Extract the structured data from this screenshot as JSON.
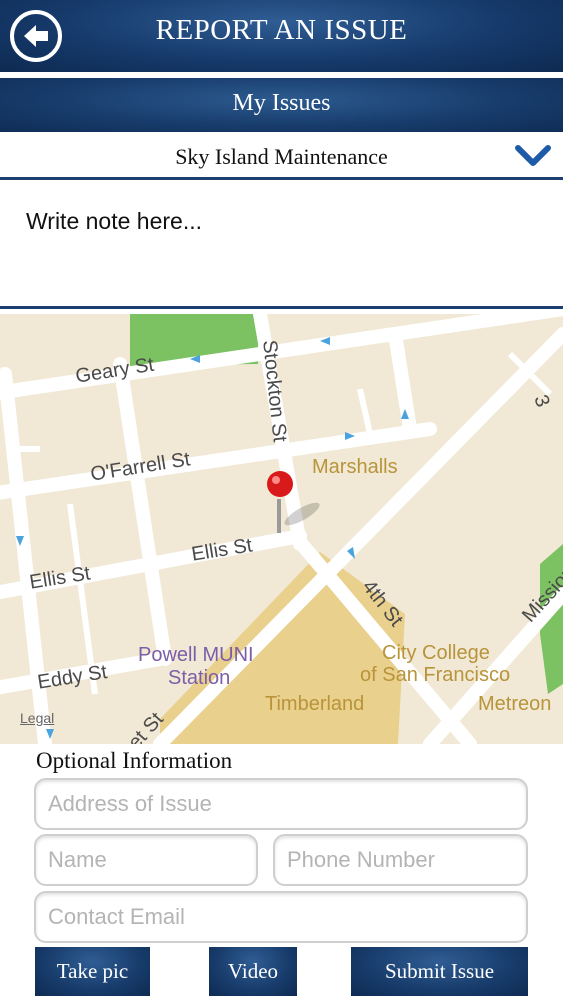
{
  "header": {
    "title": "REPORT AN ISSUE",
    "back_icon": "back-arrow-icon"
  },
  "my_issues": {
    "label": "My Issues"
  },
  "category_selector": {
    "selected": "Sky Island Maintenance",
    "icon": "chevron-down-icon"
  },
  "note": {
    "text": "Write note here..."
  },
  "map": {
    "streets": [
      "Geary St",
      "Stockton St",
      "O'Farrell St",
      "Ellis St",
      "Ellis St",
      "Eddy St",
      "4th St",
      "Mission",
      "et St",
      "3"
    ],
    "places": [
      "Marshalls",
      "Powell MUNI",
      "Station",
      "City College",
      "of San Francisco",
      "Timberland",
      "Metreon"
    ],
    "legal": "Legal",
    "pin_icon": "map-pin-icon"
  },
  "optional": {
    "title": "Optional Information",
    "address_placeholder": "Address of Issue",
    "name_placeholder": "Name",
    "phone_placeholder": "Phone Number",
    "email_placeholder": "Contact Email"
  },
  "actions": {
    "take_pic": "Take pic",
    "video": "Video",
    "submit": "Submit Issue"
  },
  "colors": {
    "navy": "#163a6b",
    "map_bg": "#f1e9d6",
    "park": "#6fbf5a",
    "poi": "#b8943a",
    "pin": "#d91a1a"
  }
}
